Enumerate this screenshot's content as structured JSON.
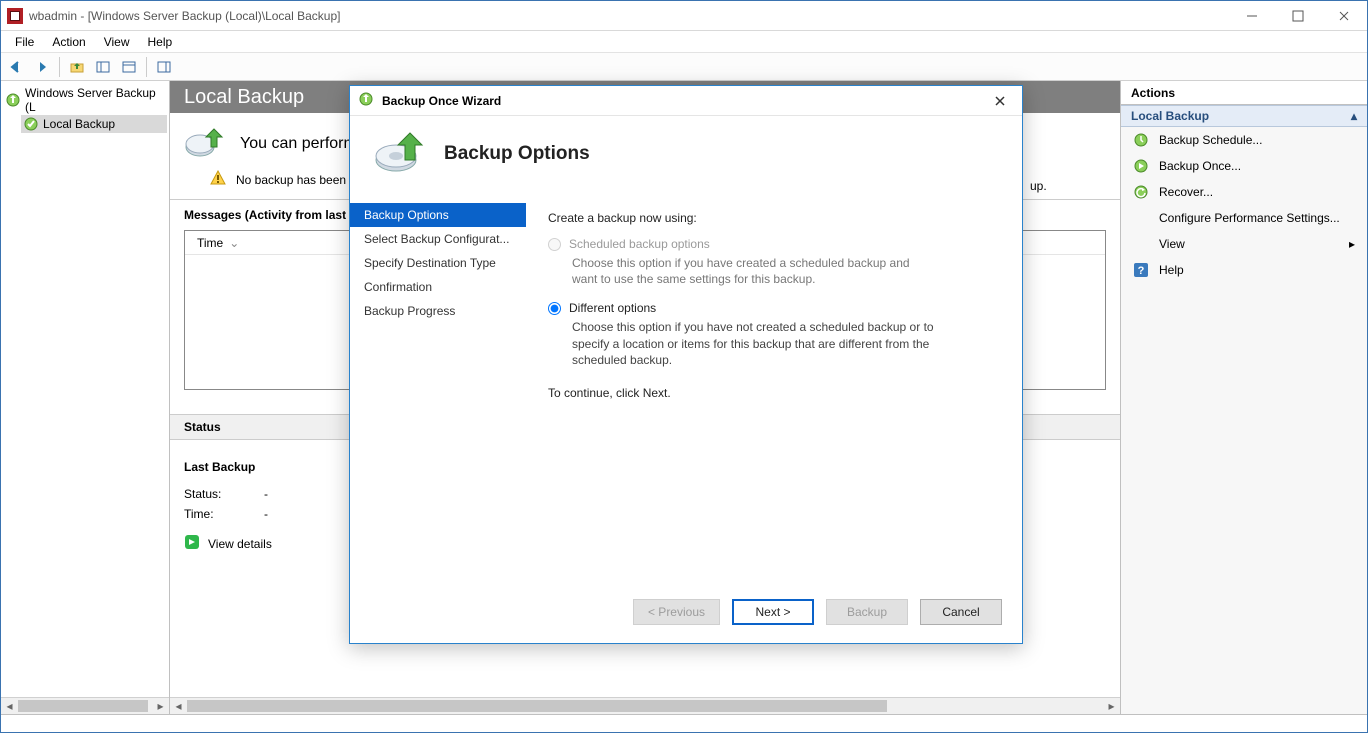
{
  "titlebar": {
    "text": "wbadmin - [Windows Server Backup (Local)\\Local Backup]"
  },
  "menubar": [
    "File",
    "Action",
    "View",
    "Help"
  ],
  "toolbar_icons": [
    "back-icon",
    "forward-icon",
    "up-icon",
    "show-hide-tree-icon",
    "properties-icon",
    "refresh-icon",
    "help-icon"
  ],
  "tree": {
    "root": "Windows Server Backup (L",
    "child": "Local Backup"
  },
  "center": {
    "header": "Local Backup",
    "perform_text": "You can perform ",
    "warn_text": "No backup has been co",
    "trailing_text": "up.",
    "messages_label": "Messages (Activity from last w",
    "table_col_time": "Time",
    "status_label": "Status",
    "last_backup_label": "Last Backup",
    "status_key": "Status:",
    "status_val": "-",
    "time_key": "Time:",
    "time_val": "-",
    "view_details_label": "View details"
  },
  "actions": {
    "header": "Actions",
    "group": "Local Backup",
    "items": [
      {
        "icon": "schedule-icon",
        "label": "Backup Schedule..."
      },
      {
        "icon": "once-icon",
        "label": "Backup Once..."
      },
      {
        "icon": "recover-icon",
        "label": "Recover..."
      },
      {
        "icon": "blank",
        "label": "Configure Performance Settings..."
      },
      {
        "icon": "blank",
        "label": "View",
        "has_arrow": true
      },
      {
        "icon": "help-icon",
        "label": "Help"
      }
    ]
  },
  "dialog": {
    "title": "Backup Once Wizard",
    "heading": "Backup Options",
    "steps": [
      "Backup Options",
      "Select Backup Configurat...",
      "Specify Destination Type",
      "Confirmation",
      "Backup Progress"
    ],
    "active_step": 0,
    "prompt": "Create a backup now using:",
    "opt1_label": "Scheduled backup options",
    "opt1_desc": "Choose this option if you have created a scheduled backup and want to use the same settings for this backup.",
    "opt2_label": "Different options",
    "opt2_desc": "Choose this option if you have not created a scheduled backup or to specify a location or items for this backup that are different from the scheduled backup.",
    "continue_text": "To continue, click Next.",
    "buttons": {
      "prev": "< Previous",
      "next": "Next >",
      "backup": "Backup",
      "cancel": "Cancel"
    }
  }
}
